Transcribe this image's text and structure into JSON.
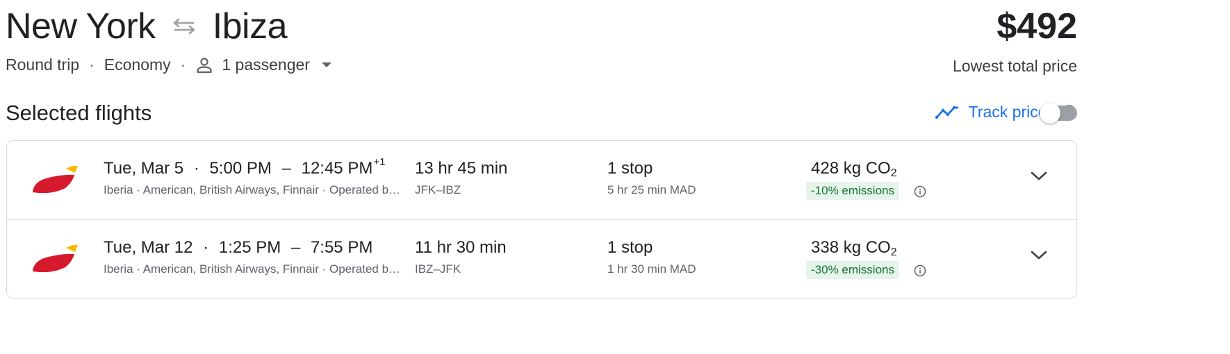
{
  "header": {
    "origin": "New York",
    "destination": "Ibiza",
    "price": "$492",
    "price_caption": "Lowest total price"
  },
  "trip_options": {
    "trip_type": "Round trip",
    "cabin_class": "Economy",
    "passengers": "1 passenger",
    "separator": "·"
  },
  "section": {
    "title": "Selected flights"
  },
  "track_prices": {
    "label": "Track prices",
    "enabled": false
  },
  "flights": [
    {
      "date": "Tue, Mar 5",
      "departure": "5:00 PM",
      "dash": "–",
      "arrival": "12:45 PM",
      "day_offset": "+1",
      "airlines": "Iberia · American, British Airways, Finnair · Operated by Air Europa",
      "duration": "13 hr 45 min",
      "route": "JFK–IBZ",
      "stops": "1 stop",
      "layover": "5 hr 25 min MAD",
      "emissions_value": "428 kg CO",
      "emissions_sub": "2",
      "emissions_change": "-10% emissions"
    },
    {
      "date": "Tue, Mar 12",
      "departure": "1:25 PM",
      "dash": "–",
      "arrival": "7:55 PM",
      "day_offset": "",
      "airlines": "Iberia · American, British Airways, Finnair · Operated by Air Europa",
      "duration": "11 hr 30 min",
      "route": "IBZ–JFK",
      "stops": "1 stop",
      "layover": "1 hr 30 min MAD",
      "emissions_value": "338 kg CO",
      "emissions_sub": "2",
      "emissions_change": "-30% emissions"
    }
  ],
  "icons": {
    "swap": "swap-arrows-icon",
    "person": "person-icon",
    "dropdown": "caret-down-icon",
    "trend": "price-trend-icon",
    "info": "info-icon",
    "airline_logo": "iberia-logo",
    "expand": "chevron-down-icon"
  },
  "colors": {
    "accent": "#1a73e8",
    "emissions_badge_bg": "#e6f4ea",
    "emissions_badge_text": "#137333",
    "logo_red": "#d7192d",
    "logo_yellow": "#fbb800"
  }
}
